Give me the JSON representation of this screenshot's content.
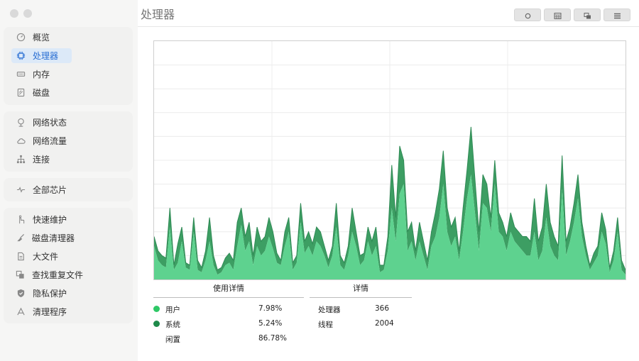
{
  "header": {
    "title": "处理器"
  },
  "sidebar": {
    "groups": [
      {
        "items": [
          {
            "label": "概览",
            "icon": "gauge-icon"
          },
          {
            "label": "处理器",
            "icon": "cpu-icon",
            "active": true
          },
          {
            "label": "内存",
            "icon": "memory-icon"
          },
          {
            "label": "磁盘",
            "icon": "disk-icon"
          }
        ]
      },
      {
        "items": [
          {
            "label": "网络状态",
            "icon": "network-status-icon"
          },
          {
            "label": "网络流量",
            "icon": "cloud-icon"
          },
          {
            "label": "连接",
            "icon": "connections-icon"
          }
        ]
      },
      {
        "items": [
          {
            "label": "全部芯片",
            "icon": "pulse-icon"
          }
        ]
      },
      {
        "items": [
          {
            "label": "快速维护",
            "icon": "hand-icon"
          },
          {
            "label": "磁盘清理器",
            "icon": "broom-icon"
          },
          {
            "label": "大文件",
            "icon": "file-icon"
          },
          {
            "label": "查找重复文件",
            "icon": "duplicate-icon"
          },
          {
            "label": "隐私保护",
            "icon": "shield-icon"
          },
          {
            "label": "清理程序",
            "icon": "uninstall-icon"
          }
        ]
      }
    ]
  },
  "toolbar": {
    "buttons": [
      "record-icon",
      "calendar-icon",
      "windows-icon",
      "list-icon"
    ]
  },
  "usage": {
    "title": "使用详情",
    "rows": [
      {
        "label": "用户",
        "value": "7.98%",
        "color": "#2ec866"
      },
      {
        "label": "系统",
        "value": "5.24%",
        "color": "#1e8a4a"
      },
      {
        "label": "闲置",
        "value": "86.78%",
        "color": null
      }
    ]
  },
  "details": {
    "title": "详情",
    "rows": [
      {
        "label": "处理器",
        "value": "366"
      },
      {
        "label": "线程",
        "value": "2004"
      }
    ]
  },
  "chart_data": {
    "type": "area",
    "ylim": [
      0,
      100
    ],
    "grid": true,
    "colors": {
      "user": "#5ed28f",
      "system": "#3d9e63"
    },
    "series": [
      {
        "name": "用户",
        "values": [
          14,
          8,
          6,
          5,
          22,
          4,
          7,
          16,
          5,
          4,
          20,
          4,
          3,
          8,
          16,
          6,
          2,
          3,
          6,
          7,
          4,
          14,
          23,
          12,
          16,
          6,
          14,
          10,
          12,
          18,
          13,
          7,
          6,
          14,
          20,
          4,
          7,
          24,
          11,
          14,
          10,
          16,
          14,
          10,
          5,
          10,
          22,
          6,
          4,
          10,
          20,
          14,
          6,
          8,
          16,
          10,
          14,
          3,
          4,
          12,
          30,
          16,
          36,
          40,
          12,
          16,
          8,
          16,
          10,
          4,
          14,
          18,
          26,
          40,
          20,
          14,
          18,
          8,
          20,
          34,
          44,
          28,
          12,
          32,
          30,
          20,
          40,
          20,
          18,
          12,
          20,
          16,
          14,
          12,
          10,
          10,
          20,
          8,
          12,
          26,
          14,
          10,
          8,
          38,
          10,
          16,
          24,
          34,
          18,
          10,
          4,
          7,
          10,
          20,
          15,
          3,
          8,
          20,
          4,
          2
        ]
      },
      {
        "name": "系统",
        "values": [
          4,
          4,
          4,
          4,
          8,
          2,
          8,
          6,
          2,
          2,
          6,
          4,
          2,
          4,
          10,
          4,
          2,
          2,
          3,
          4,
          4,
          10,
          7,
          6,
          8,
          4,
          8,
          6,
          6,
          8,
          7,
          4,
          2,
          6,
          6,
          3,
          3,
          8,
          5,
          6,
          5,
          6,
          6,
          4,
          3,
          4,
          10,
          4,
          3,
          4,
          10,
          6,
          4,
          3,
          6,
          6,
          8,
          3,
          2,
          6,
          18,
          10,
          20,
          10,
          8,
          8,
          4,
          8,
          6,
          4,
          6,
          10,
          12,
          14,
          10,
          8,
          8,
          4,
          10,
          12,
          20,
          14,
          8,
          12,
          10,
          6,
          10,
          8,
          6,
          6,
          8,
          6,
          6,
          6,
          8,
          6,
          14,
          8,
          10,
          14,
          10,
          8,
          6,
          14,
          6,
          6,
          8,
          10,
          6,
          4,
          2,
          4,
          4,
          8,
          6,
          2,
          4,
          6,
          4,
          2
        ]
      }
    ]
  }
}
